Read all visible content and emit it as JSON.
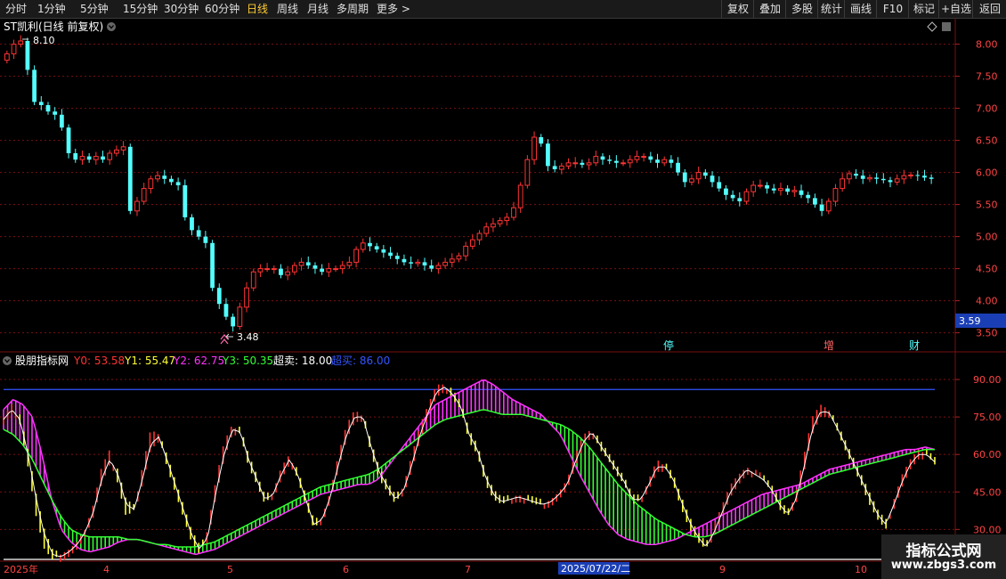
{
  "toolbar": {
    "periods": [
      "分时",
      "1分钟",
      "5分钟",
      "15分钟",
      "30分钟",
      "60分钟",
      "日线",
      "周线",
      "月线",
      "多周期",
      "更多 >"
    ],
    "active_period": "日线",
    "actions": [
      "复权",
      "叠加",
      "多股",
      "统计",
      "画线",
      "F10",
      "标记",
      "+自选",
      "返回"
    ]
  },
  "main_panel": {
    "title": "ST凯利(日线 前复权)",
    "y_ticks": [
      "8.00",
      "7.50",
      "7.00",
      "6.50",
      "6.00",
      "5.50",
      "5.00",
      "4.50",
      "4.00",
      "3.50"
    ],
    "high_label": "8.10",
    "low_label": "3.48",
    "current_price": "3.59",
    "markers": [
      "停",
      "增",
      "财"
    ]
  },
  "indicator_panel": {
    "title": "股朋指标网",
    "legend": [
      {
        "key": "Y0",
        "value": "53.58",
        "color": "#ff3333"
      },
      {
        "key": "Y1",
        "value": "55.47",
        "color": "#ffff33"
      },
      {
        "key": "Y2",
        "value": "62.75",
        "color": "#ff33ff"
      },
      {
        "key": "Y3",
        "value": "50.35",
        "color": "#33ff33"
      },
      {
        "key": "超卖",
        "value": "18.00",
        "color": "#ffffff"
      },
      {
        "key": "超买",
        "value": "86.00",
        "color": "#3355ff"
      }
    ],
    "y_ticks": [
      "90.00",
      "75.00",
      "60.00",
      "45.00",
      "30.00"
    ]
  },
  "x_axis": {
    "labels": [
      "2025年",
      "4",
      "5",
      "6",
      "7",
      "9",
      "10"
    ],
    "cursor_label": "2025/07/22/二"
  },
  "watermark": {
    "line1": "指标公式网",
    "line2": "www.zbgs3.com"
  },
  "colors": {
    "up": "#ff3333",
    "down": "#54ffff",
    "y0": "#ff3333",
    "y1": "#ffff33",
    "y2": "#ff33ff",
    "y3": "#33ff33",
    "overbought": "#3355ff",
    "oversold": "#ffffff",
    "grid": "#7a1010"
  },
  "chart_data": [
    {
      "type": "candlestick",
      "title": "ST凯利(日线 前复权)",
      "ylim": [
        3.3,
        8.3
      ],
      "x_labels": [
        "2025年",
        "4",
        "5",
        "6",
        "7",
        "9",
        "10"
      ],
      "close": [
        7.85,
        8.0,
        8.05,
        7.6,
        7.1,
        7.05,
        6.95,
        6.9,
        6.7,
        6.3,
        6.2,
        6.25,
        6.2,
        6.25,
        6.2,
        6.3,
        6.35,
        6.4,
        5.4,
        5.55,
        5.75,
        5.9,
        5.95,
        5.9,
        5.85,
        5.8,
        5.3,
        5.1,
        5.0,
        4.9,
        4.2,
        3.95,
        3.75,
        3.6,
        3.9,
        4.2,
        4.45,
        4.5,
        4.5,
        4.5,
        4.4,
        4.45,
        4.55,
        4.6,
        4.55,
        4.5,
        4.45,
        4.5,
        4.5,
        4.55,
        4.6,
        4.8,
        4.9,
        4.85,
        4.8,
        4.75,
        4.7,
        4.65,
        4.6,
        4.58,
        4.6,
        4.55,
        4.5,
        4.55,
        4.6,
        4.65,
        4.7,
        4.85,
        4.95,
        5.05,
        5.15,
        5.2,
        5.25,
        5.3,
        5.45,
        5.8,
        6.2,
        6.55,
        6.45,
        6.1,
        6.05,
        6.1,
        6.15,
        6.15,
        6.12,
        6.15,
        6.25,
        6.2,
        6.18,
        6.15,
        6.15,
        6.2,
        6.25,
        6.25,
        6.2,
        6.15,
        6.2,
        6.15,
        6.0,
        5.85,
        5.9,
        6.0,
        5.95,
        5.85,
        5.75,
        5.65,
        5.6,
        5.55,
        5.7,
        5.8,
        5.8,
        5.75,
        5.72,
        5.75,
        5.7,
        5.72,
        5.65,
        5.6,
        5.5,
        5.4,
        5.55,
        5.75,
        5.9,
        5.98,
        5.95,
        5.9,
        5.92,
        5.9,
        5.88,
        5.85,
        5.9,
        5.95,
        5.96,
        5.95,
        5.92,
        5.9
      ]
    },
    {
      "type": "line",
      "title": "股朋指标网",
      "ylim": [
        18,
        95
      ],
      "series": [
        {
          "name": "Y0",
          "values": [
            75,
            80,
            72,
            55,
            35,
            22,
            18,
            20,
            22,
            25,
            30,
            40,
            55,
            62,
            48,
            35,
            38,
            55,
            70,
            68,
            55,
            45,
            35,
            25,
            20,
            30,
            50,
            65,
            72,
            68,
            55,
            48,
            40,
            45,
            55,
            60,
            50,
            40,
            30,
            35,
            45,
            60,
            72,
            78,
            75,
            60,
            50,
            45,
            40,
            48,
            60,
            72,
            80,
            88,
            88,
            82,
            78,
            65,
            60,
            48,
            42,
            40,
            42,
            44,
            42,
            40,
            40,
            42,
            45,
            50,
            60,
            68,
            70,
            62,
            58,
            52,
            48,
            40,
            42,
            50,
            58,
            55,
            48,
            38,
            30,
            25,
            22,
            32,
            40,
            48,
            52,
            55,
            52,
            50,
            45,
            38,
            35,
            45,
            60,
            75,
            80,
            78,
            70,
            62,
            55,
            48,
            40,
            34,
            30,
            42,
            52,
            58,
            62,
            60,
            56
          ]
        },
        {
          "name": "Y1",
          "values": [
            74,
            78,
            74,
            60,
            42,
            28,
            20,
            19,
            21,
            24,
            29,
            37,
            50,
            58,
            52,
            40,
            38,
            50,
            64,
            67,
            58,
            48,
            38,
            28,
            22,
            27,
            45,
            60,
            70,
            69,
            58,
            50,
            42,
            44,
            52,
            58,
            52,
            42,
            32,
            34,
            43,
            56,
            68,
            75,
            75,
            63,
            53,
            47,
            42,
            46,
            56,
            68,
            77,
            85,
            87,
            84,
            79,
            68,
            62,
            51,
            44,
            41,
            42,
            43,
            42,
            41,
            40,
            41,
            44,
            48,
            57,
            65,
            69,
            64,
            59,
            54,
            49,
            42,
            42,
            48,
            55,
            55,
            50,
            41,
            33,
            27,
            23,
            29,
            37,
            45,
            50,
            54,
            52,
            50,
            46,
            40,
            36,
            42,
            55,
            70,
            77,
            77,
            71,
            64,
            57,
            50,
            43,
            36,
            32,
            40,
            49,
            56,
            60,
            60,
            57
          ]
        },
        {
          "name": "Y2",
          "values": [
            78,
            82,
            80,
            75,
            60,
            42,
            30,
            25,
            22,
            21,
            22,
            23,
            25,
            26,
            26,
            25,
            24,
            23,
            22,
            21,
            20,
            21,
            22,
            24,
            26,
            28,
            30,
            32,
            34,
            36,
            38,
            40,
            42,
            44,
            45,
            46,
            47,
            48,
            48,
            50,
            55,
            60,
            65,
            70,
            75,
            80,
            82,
            84,
            86,
            88,
            90,
            88,
            85,
            82,
            80,
            78,
            76,
            72,
            68,
            60,
            52,
            45,
            38,
            32,
            28,
            26,
            25,
            24,
            24,
            25,
            26,
            28,
            30,
            32,
            34,
            36,
            38,
            40,
            42,
            44,
            45,
            46,
            47,
            48,
            50,
            52,
            54,
            55,
            56,
            57,
            58,
            59,
            60,
            61,
            62,
            62,
            63,
            62
          ]
        },
        {
          "name": "Y3",
          "values": [
            70,
            68,
            64,
            58,
            50,
            42,
            35,
            30,
            28,
            27,
            27,
            27,
            27,
            26,
            26,
            25,
            24,
            24,
            23,
            23,
            23,
            24,
            25,
            27,
            29,
            31,
            33,
            35,
            37,
            39,
            41,
            43,
            45,
            47,
            48,
            49,
            50,
            51,
            52,
            54,
            57,
            60,
            63,
            66,
            69,
            72,
            74,
            75,
            76,
            77,
            78,
            77,
            76,
            76,
            76,
            75,
            74,
            73,
            72,
            70,
            67,
            63,
            58,
            53,
            48,
            44,
            40,
            37,
            34,
            32,
            30,
            28,
            27,
            27,
            28,
            30,
            32,
            34,
            36,
            38,
            40,
            42,
            44,
            46,
            48,
            50,
            52,
            53,
            54,
            55,
            56,
            57,
            58,
            59,
            60,
            61,
            62,
            62
          ]
        },
        {
          "name": "超卖",
          "values": [
            18
          ]
        },
        {
          "name": "超买",
          "values": [
            86
          ]
        }
      ]
    }
  ]
}
